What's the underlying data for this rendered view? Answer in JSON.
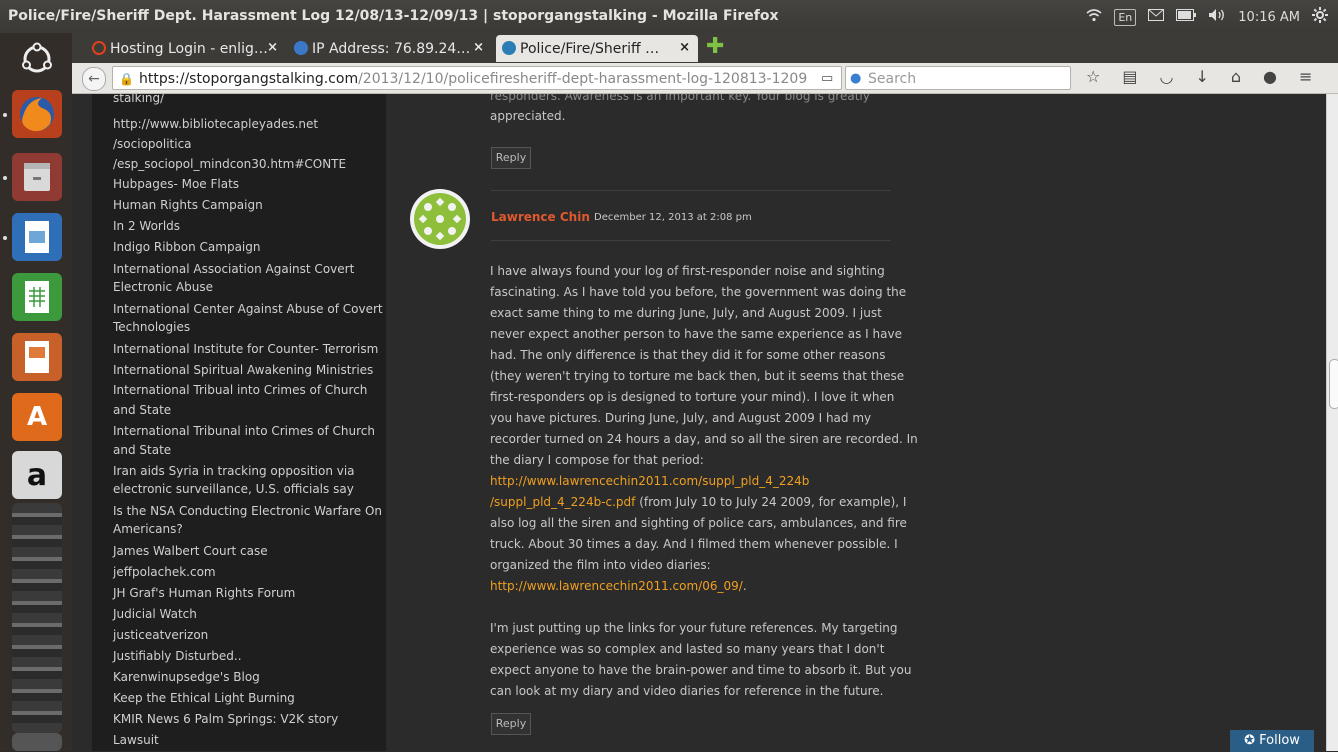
{
  "window": {
    "title": "Police/Fire/Sheriff Dept. Harassment Log 12/08/13-12/09/13 | stoporgangstalking - Mozilla Firefox"
  },
  "panel": {
    "keyboard": "En",
    "time": "10:16 AM"
  },
  "tabs": [
    {
      "label": "Hosting Login - enlig…",
      "close": "×",
      "icon_color": "#e0401c"
    },
    {
      "label": "IP Address: 76.89.24…",
      "close": "×",
      "icon_color": "#3c78c8"
    },
    {
      "label": "Police/Fire/Sheriff …",
      "close": "×",
      "icon_color": "#2b7eb5"
    }
  ],
  "newtab": "✚",
  "navbar": {
    "url_host": "https://stoporgangstalking.com",
    "url_path": "/2013/12/10/policefiresheriff-dept-harassment-log-120813-1209",
    "search_placeholder": "Search"
  },
  "sidebar_links": [
    "stalking/",
    "http://www.bibliotecapleyades.net",
    "/sociopolitica",
    "/esp_sociopol_mindcon30.htm#CONTE",
    "Hubpages- Moe Flats",
    "Human Rights Campaign",
    "In 2 Worlds",
    "Indigo Ribbon Campaign",
    "International Association Against Covert",
    "Electronic Abuse",
    "International Center Against Abuse of Covert",
    "Technologies",
    "International Institute for Counter- Terrorism",
    "International Spiritual Awakening Ministries",
    "International Tribual into Crimes of Church",
    "and State",
    "International Tribunal into Crimes of Church",
    "and State",
    "Iran aids Syria in tracking opposition via",
    "electronic surveillance, U.S. officials say",
    "Is the NSA Conducting Electronic Warfare On",
    "Americans?",
    "James Walbert Court case",
    "jeffpolachek.com",
    "JH Graf's Human Rights Forum",
    "Judicial Watch",
    "justiceatverizon",
    "Justifiably Disturbed..",
    "Karenwinupsedge's Blog",
    "Keep the Ethical Light Burning",
    "KMIR News 6 Palm Springs: V2K story",
    "Lawsuit"
  ],
  "prev_comment": {
    "tail": "responders. Awareness is an important key. Your blog is greatly",
    "last_line": "appreciated.",
    "reply": "Reply"
  },
  "comment": {
    "author": "Lawrence Chin",
    "date": "December 12, 2013 at 2:08 pm",
    "lines": [
      "I have always found your log of first-responder noise and sighting",
      "fascinating. As I have told you before, the government was doing the",
      "exact same thing to me during June, July, and August 2009. I just",
      "never expect another person to have the same experience as I have",
      "had. The only difference is that they did it for some other reasons",
      "(they weren't trying to torture me back then, but it seems that these",
      "first-responders op is designed to torture your mind). I love it when",
      "you have pictures. During June, July, and August 2009 I had my",
      "recorder turned on 24 hours a day, and so all the siren are recorded. In",
      "the diary I compose for that period:"
    ],
    "link1a": "http://www.lawrencechin2011.com/suppl_pld_4_224b",
    "link1b": "/suppl_pld_4_224b-c.pdf",
    "after_link1": " (from July 10 to July 24 2009, for example), I",
    "lines2": [
      "also log all the siren and sighting of police cars, ambulances, and fire",
      "truck. About 30 times a day. And I filmed them whenever possible. I",
      "organized the film into video diaries:"
    ],
    "link2": "http://www.lawrencechin2011.com/06_09/",
    "link2_after": ".",
    "lines3": [
      "I'm just putting up the links for your future references. My targeting",
      "experience was so complex and lasted so many years that I don't",
      "expect anyone to have the brain-power and time to absorb it. But you",
      "can look at my diary and video diaries for reference in the future."
    ],
    "reply": "Reply"
  },
  "follow": "Follow",
  "follow_icon": "✪"
}
